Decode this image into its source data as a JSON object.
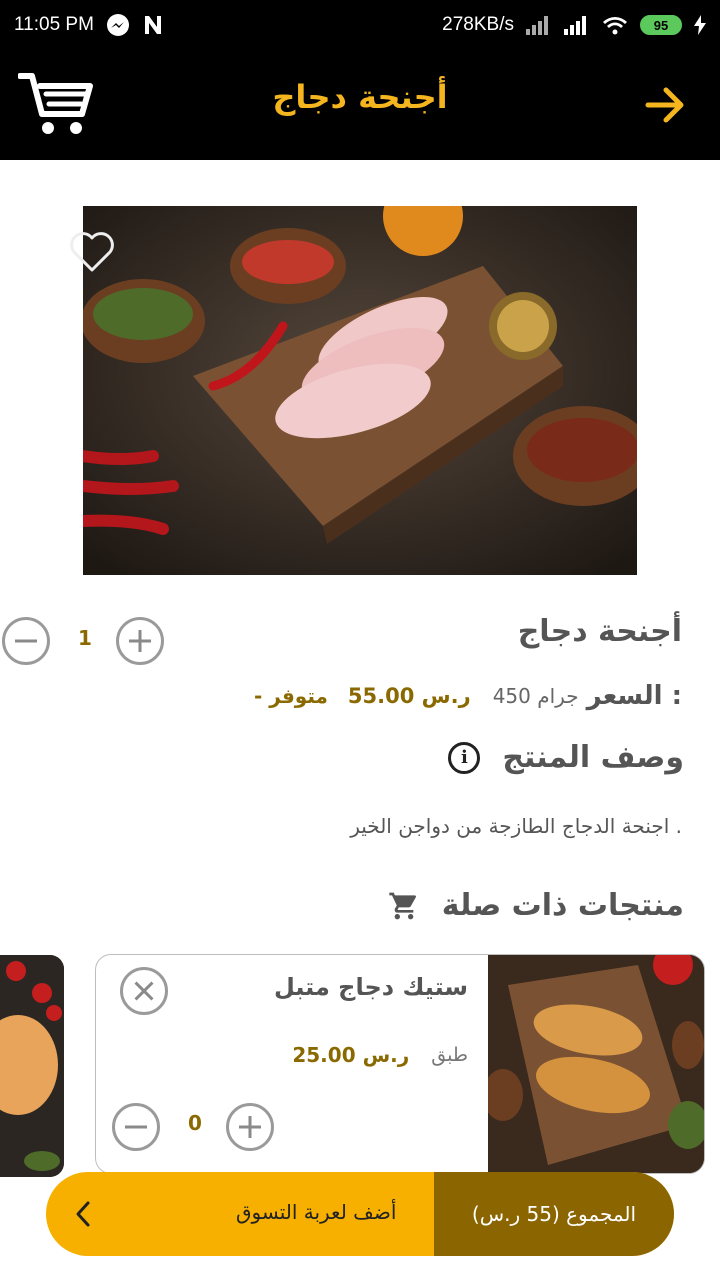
{
  "status_bar": {
    "time": "11:05 PM",
    "speed": "278KB/s",
    "battery": "95",
    "icons": [
      "messenger-icon",
      "n-icon",
      "signal-icon",
      "wifi-icon",
      "battery-icon",
      "charging-icon"
    ]
  },
  "header": {
    "title": "أجنحة دجاج",
    "cart_icon": "cart-icon",
    "back_icon": "arrow-right-icon"
  },
  "product": {
    "name": "أجنحة دجاج",
    "price_label": "السعر :",
    "weight": "450 جرام",
    "price": "55.00 ر.س",
    "stock": "- متوفر",
    "quantity": "1",
    "description_title": "وصف المنتج",
    "description": "اجنحة الدجاج الطازجة من دواجن الخير ."
  },
  "related": {
    "title": "منتجات ذات صلة",
    "items": [
      {
        "name": "ستيك دجاج متبل",
        "unit": "طبق",
        "price": "25.00 ر.س",
        "quantity": "0"
      }
    ]
  },
  "bottom_bar": {
    "total": "المجموع (55 ر.س)",
    "add_to_cart": "أضف لعربة التسوق",
    "chevron_icon": "chevron-left-icon"
  },
  "colors": {
    "accent": "#f5b51e",
    "dark_gold": "#8a6500",
    "header_bg": "#000000"
  }
}
